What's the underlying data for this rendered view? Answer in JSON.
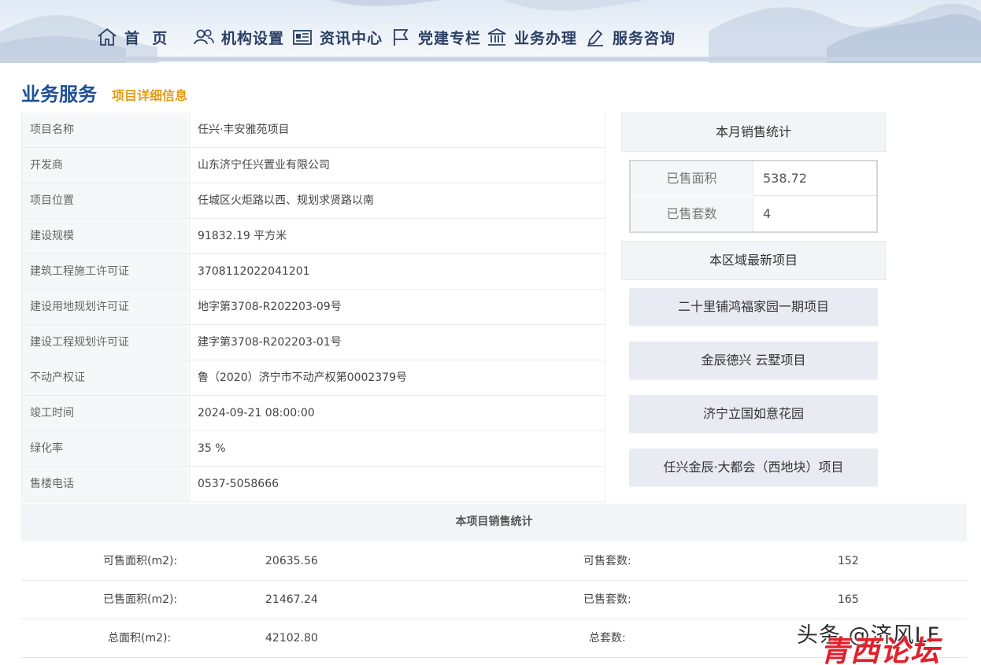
{
  "nav": {
    "items": [
      {
        "icon": "home-icon",
        "label": "首  页"
      },
      {
        "icon": "users-icon",
        "label": "机构设置"
      },
      {
        "icon": "news-icon",
        "label": "资讯中心"
      },
      {
        "icon": "flag-icon",
        "label": "党建专栏"
      },
      {
        "icon": "bank-icon",
        "label": "业务办理"
      },
      {
        "icon": "edit-icon",
        "label": "服务咨询"
      }
    ]
  },
  "section": {
    "title": "业务服务",
    "subtitle": "项目详细信息"
  },
  "details": [
    {
      "key": "项目名称",
      "value": "任兴·丰安雅苑项目"
    },
    {
      "key": "开发商",
      "value": "山东济宁任兴置业有限公司"
    },
    {
      "key": "项目位置",
      "value": "任城区火炬路以西、规划求贤路以南"
    },
    {
      "key": "建设规模",
      "value": "91832.19 平方米"
    },
    {
      "key": "建筑工程施工许可证",
      "value": "3708112022041201"
    },
    {
      "key": "建设用地规划许可证",
      "value": "地字第3708-R202203-09号"
    },
    {
      "key": "建设工程规划许可证",
      "value": "建字第3708-R202203-01号"
    },
    {
      "key": "不动产权证",
      "value": "鲁（2020）济宁市不动产权第0002379号"
    },
    {
      "key": "竣工时间",
      "value": "2024-09-21 08:00:00"
    },
    {
      "key": "绿化率",
      "value": "35 %"
    },
    {
      "key": "售楼电话",
      "value": "0537-5058666"
    }
  ],
  "monthly": {
    "title": "本月销售统计",
    "rows": [
      {
        "key": "已售面积",
        "value": "538.72"
      },
      {
        "key": "已售套数",
        "value": "4"
      }
    ]
  },
  "region": {
    "title": "本区域最新项目",
    "projects": [
      "二十里铺鸿福家园一期项目",
      "金辰德兴 云墅项目",
      "济宁立国如意花园",
      "任兴金辰·大都会（西地块）项目"
    ]
  },
  "project_stats": {
    "title": "本项目销售统计",
    "rows": [
      {
        "label1": "可售面积(m2):",
        "value1": "20635.56",
        "label2": "可售套数:",
        "value2": "152"
      },
      {
        "label1": "已售面积(m2):",
        "value1": "21467.24",
        "label2": "已售套数:",
        "value2": "165"
      },
      {
        "label1": "总面积(m2):",
        "value1": "42102.80",
        "label2": "总套数:",
        "value2": ""
      }
    ]
  },
  "watermark": {
    "line1": "头条 @济风LF",
    "line2": "青西论坛"
  }
}
